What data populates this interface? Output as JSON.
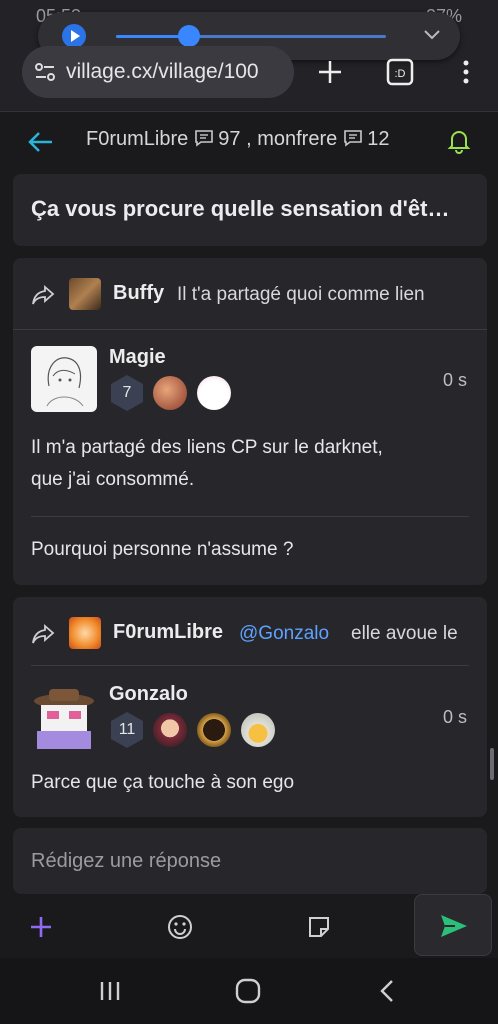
{
  "status_bar": {
    "time": "05:53",
    "battery": "27%"
  },
  "media_player": {
    "progress": 0.27
  },
  "browser": {
    "url": "village.cx/village/100",
    "tabs_icon_label": ":D"
  },
  "thread_header": {
    "title_user1": "F0rumLibre",
    "count1": "97",
    "separator": ",",
    "title_user2": "monfrere",
    "count2": "12",
    "accent_color": "#2bb3d8",
    "bell_color": "#9be04d"
  },
  "topic": {
    "title": "Ça vous procure quelle sensation d'êt…"
  },
  "posts": [
    {
      "share_author": "Buffy",
      "share_text": "Il t'a partagé quoi comme lien",
      "author": "Magie",
      "level": "7",
      "time": "0 s",
      "body_p1_line1": "Il m'a partagé des liens CP sur le darknet,",
      "body_p1_line2": "que j'ai consommé.",
      "body_p2": "Pourquoi personne n'assume ?"
    },
    {
      "share_author": "F0rumLibre",
      "share_mention": "@Gonzalo",
      "share_text": "elle avoue le",
      "author": "Gonzalo",
      "level": "11",
      "time": "0 s",
      "body_p1": "Parce que ça touche à son ego"
    }
  ],
  "reply": {
    "placeholder": "Rédigez une réponse"
  },
  "composer": {
    "send_color": "#2bbf7a",
    "plus_color": "#8f6bf2"
  }
}
